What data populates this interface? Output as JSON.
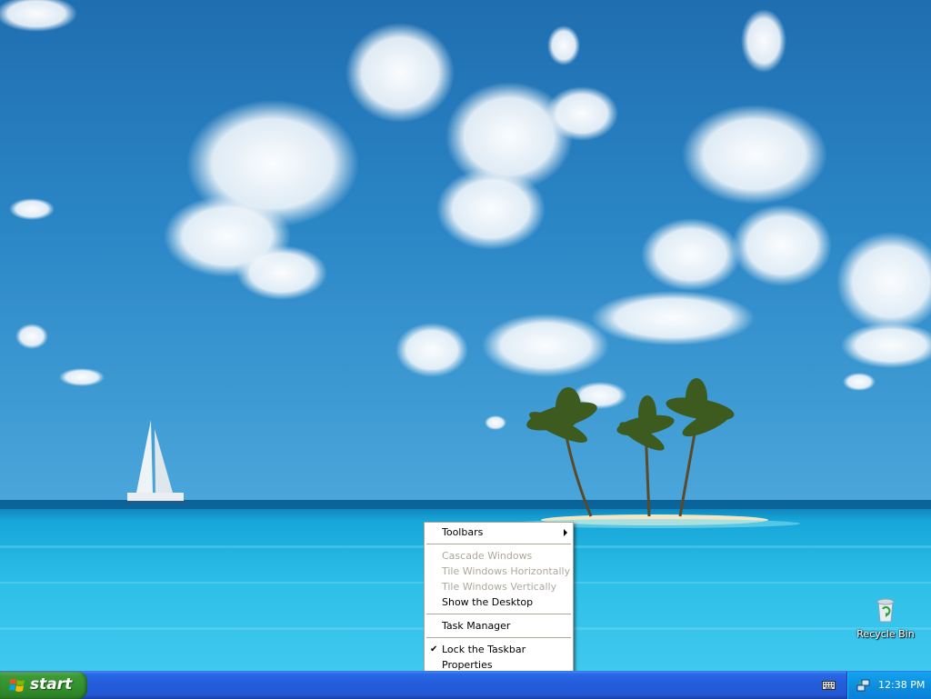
{
  "desktop": {
    "icons": [
      {
        "label": "Recycle Bin",
        "icon": "recycle-bin-icon"
      }
    ]
  },
  "context_menu": {
    "items": [
      {
        "label": "Toolbars",
        "submenu": true,
        "enabled": true
      },
      {
        "label": "Cascade Windows",
        "enabled": false
      },
      {
        "label": "Tile Windows Horizontally",
        "enabled": false
      },
      {
        "label": "Tile Windows Vertically",
        "enabled": false
      },
      {
        "label": "Show the Desktop",
        "enabled": true
      },
      {
        "label": "Task Manager",
        "enabled": true
      },
      {
        "label": "Lock the Taskbar",
        "checked": true,
        "enabled": true
      },
      {
        "label": "Properties",
        "enabled": true
      }
    ]
  },
  "taskbar": {
    "start_label": "start",
    "tray_icons": [
      "keyboard-icon",
      "network-icon"
    ],
    "clock": "12:38 PM"
  },
  "colors": {
    "taskbar_blue": "#245edb",
    "start_green": "#338f2d",
    "tray_blue": "#0d8fe0",
    "menu_disabled": "#aca899"
  }
}
